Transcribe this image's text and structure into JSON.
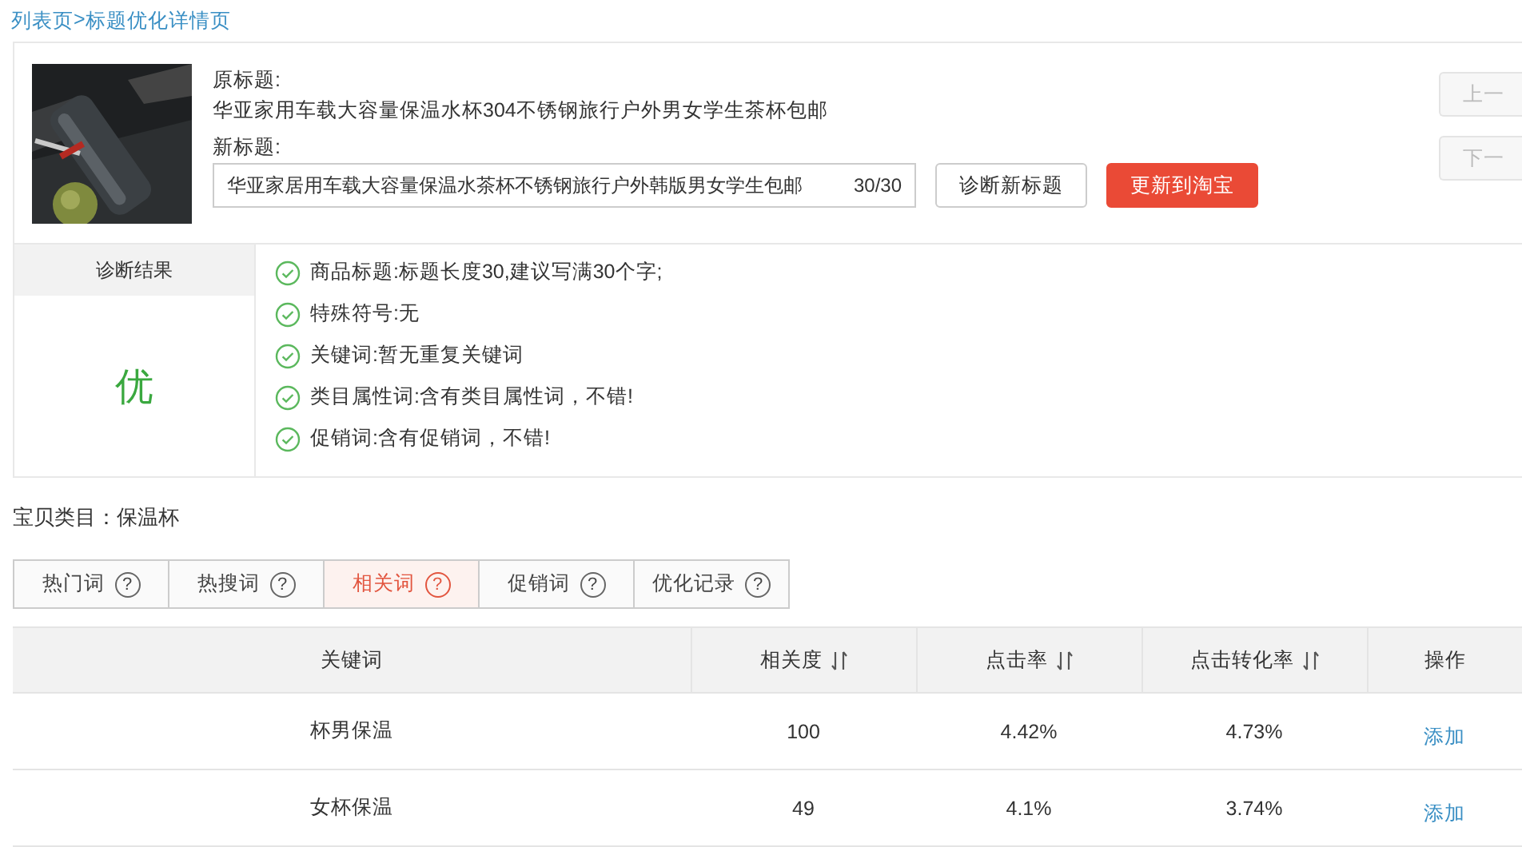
{
  "breadcrumb": {
    "list": "列表页",
    "separator": ">",
    "current": "标题优化详情页"
  },
  "product": {
    "original_label": "原标题:",
    "original_title": "华亚家用车载大容量保温水杯304不锈钢旅行户外男女学生茶杯包邮",
    "new_label": "新标题:",
    "new_title": "华亚家居用车载大容量保温水茶杯不锈钢旅行户外韩版男女学生包邮",
    "counter": "30/30",
    "diagnose_button": "诊断新标题",
    "update_button": "更新到淘宝",
    "nav_buttons": [
      {
        "label": "上一",
        "disabled": true
      },
      {
        "label": "下一",
        "disabled": true
      }
    ]
  },
  "diagnosis": {
    "header": "诊断结果",
    "grade": "优",
    "items": [
      {
        "text": "商品标题:标题长度30,建议写满30个字;",
        "passed": true
      },
      {
        "text": "特殊符号:无",
        "passed": true
      },
      {
        "text": "关键词:暂无重复关键词",
        "passed": true
      },
      {
        "text": "类目属性词:含有类目属性词，不错!",
        "passed": true
      },
      {
        "text": "促销词:含有促销词，不错!",
        "passed": true
      }
    ]
  },
  "category": "宝贝类目：保温杯",
  "tabs": [
    {
      "label": "热门词",
      "help": "?",
      "selected": false
    },
    {
      "label": "热搜词",
      "help": "?",
      "selected": false
    },
    {
      "label": "相关词",
      "help": "?",
      "selected": true
    },
    {
      "label": "促销词",
      "help": "?",
      "selected": false
    },
    {
      "label": "优化记录",
      "help": "?",
      "selected": false
    }
  ],
  "table": {
    "columns": [
      {
        "label": "关键词",
        "sortable": false
      },
      {
        "label": "相关度",
        "sortable": true
      },
      {
        "label": "点击率",
        "sortable": true
      },
      {
        "label": "点击转化率",
        "sortable": true
      },
      {
        "label": "操作",
        "sortable": false
      }
    ],
    "rows": [
      {
        "cells": [
          "杯男保温",
          "100",
          "4.42%",
          "4.73%"
        ],
        "action": "添加"
      },
      {
        "cells": [
          "女杯保温",
          "49",
          "4.1%",
          "3.74%"
        ],
        "action": "添加"
      }
    ]
  }
}
